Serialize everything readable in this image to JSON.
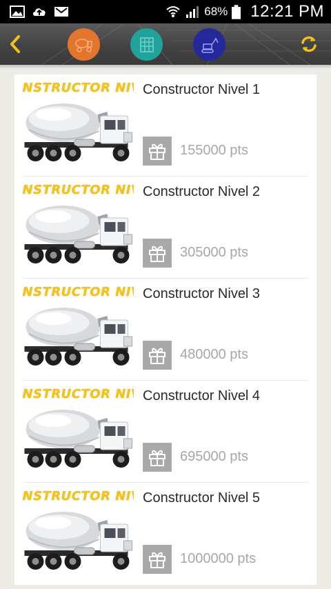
{
  "status_bar": {
    "battery": "68%",
    "time": "12:21 PM",
    "left_icons": [
      "image-icon",
      "cloud-upload-icon",
      "mail-icon"
    ],
    "right_icons": [
      "wifi-icon",
      "signal-icon",
      "battery-icon"
    ]
  },
  "header": {
    "back_icon": "chevron-left-icon",
    "refresh_icon": "refresh-icon",
    "badges": [
      {
        "icon": "concrete-mixer-icon",
        "color": "#e4752c"
      },
      {
        "icon": "building-icon",
        "color": "#20a39c"
      },
      {
        "icon": "excavator-icon",
        "color": "#23299a"
      }
    ],
    "accent_color": "#f2c01c"
  },
  "rewards": [
    {
      "banner": "CONSTRUCTOR NIVEL",
      "title": "Constructor Nivel 1",
      "points": "155000 pts",
      "icon": "gift-icon"
    },
    {
      "banner": "CONSTRUCTOR NIVEL",
      "title": "Constructor Nivel 2",
      "points": "305000 pts",
      "icon": "gift-icon"
    },
    {
      "banner": "CONSTRUCTOR NIVEL",
      "title": "Constructor Nivel 3",
      "points": "480000 pts",
      "icon": "gift-icon"
    },
    {
      "banner": "CONSTRUCTOR NIVEL",
      "title": "Constructor Nivel 4",
      "points": "695000 pts",
      "icon": "gift-icon"
    },
    {
      "banner": "CONSTRUCTOR NIVEL",
      "title": "Constructor Nivel 5",
      "points": "1000000 pts",
      "icon": "gift-icon"
    }
  ]
}
